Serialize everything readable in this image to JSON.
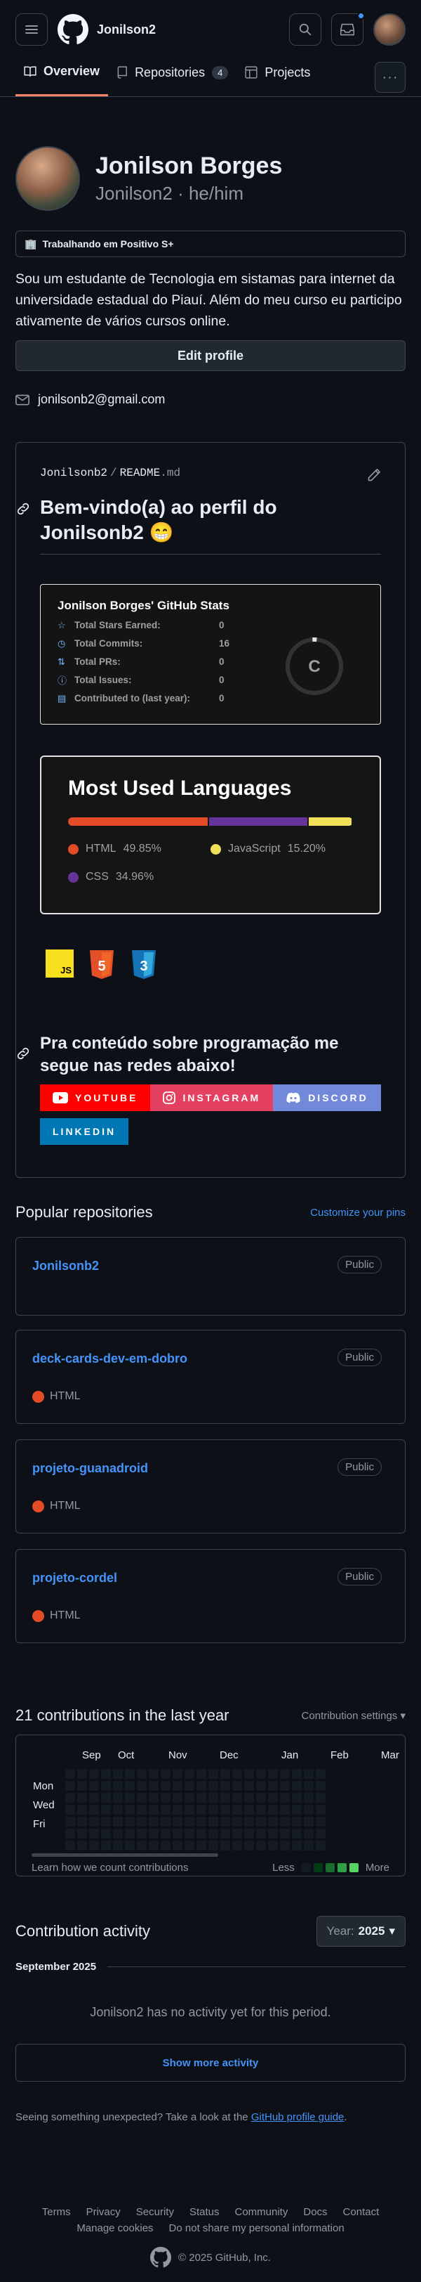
{
  "header": {
    "username": "Jonilson2"
  },
  "tabs": [
    {
      "label": "Overview"
    },
    {
      "label": "Repositories",
      "count": "4"
    },
    {
      "label": "Projects"
    }
  ],
  "profile": {
    "name": "Jonilson Borges",
    "login_pronouns": "Jonilson2 · he/him",
    "status_emoji": "🏢",
    "status": "Trabalhando em Positivo S+",
    "bio": "Sou um estudante de Tecnologia em sistamas para internet da universidade estadual do Piauí. Além do meu curso eu participo ativamente de vários cursos online.",
    "edit_label": "Edit profile",
    "email": "jonilsonb2@gmail.com"
  },
  "readme": {
    "repo": "Jonilsonb2",
    "sep": "/",
    "file": "README",
    "ext": ".md",
    "heading": "Bem-vindo(a) ao perfil do Jonilsonb2 😁",
    "stats_card": {
      "title": "Jonilson Borges' GitHub Stats",
      "rows": [
        {
          "label": "Total Stars Earned:",
          "value": "0"
        },
        {
          "label": "Total Commits:",
          "value": "16"
        },
        {
          "label": "Total PRs:",
          "value": "0"
        },
        {
          "label": "Total Issues:",
          "value": "0"
        },
        {
          "label": "Contributed to (last year):",
          "value": "0"
        }
      ],
      "rank": "C"
    },
    "langs_card": {
      "title": "Most Used Languages",
      "langs": [
        {
          "name": "HTML",
          "pct": "49.85%",
          "value": 49.85,
          "color": "#e34c26"
        },
        {
          "name": "JavaScript",
          "pct": "15.20%",
          "value": 15.2,
          "color": "#f1e05a"
        },
        {
          "name": "CSS",
          "pct": "34.96%",
          "value": 34.96,
          "color": "#663399"
        }
      ]
    },
    "tech_badges": [
      {
        "icon": "javascript-icon",
        "text": "JS"
      },
      {
        "icon": "html5-icon",
        "text": "5"
      },
      {
        "icon": "css3-icon",
        "text": "3"
      }
    ],
    "social_heading": "Pra conteúdo sobre programação me segue nas redes abaixo!",
    "socials": [
      {
        "label": "YOUTUBE",
        "color": "#ff0000",
        "icon": "youtube-icon"
      },
      {
        "label": "INSTAGRAM",
        "color": "#e4405f",
        "icon": "instagram-icon"
      },
      {
        "label": "DISCORD",
        "color": "#7289da",
        "icon": "discord-icon"
      },
      {
        "label": "LINKEDIN",
        "color": "#0077b5",
        "icon": ""
      }
    ]
  },
  "popular": {
    "title": "Popular repositories",
    "customize": "Customize your pins",
    "repos": [
      {
        "name": "Jonilsonb2",
        "visibility": "Public",
        "language": ""
      },
      {
        "name": "deck-cards-dev-em-dobro",
        "visibility": "Public",
        "language": "HTML"
      },
      {
        "name": "projeto-guanadroid",
        "visibility": "Public",
        "language": "HTML"
      },
      {
        "name": "projeto-cordel",
        "visibility": "Public",
        "language": "HTML"
      }
    ]
  },
  "contributions": {
    "title": "21 contributions in the last year",
    "settings": "Contribution settings",
    "months": [
      "Sep",
      "Oct",
      "Nov",
      "Dec",
      "Jan",
      "Feb",
      "Mar"
    ],
    "days": [
      "Mon",
      "Wed",
      "Fri"
    ],
    "learn": "Learn how we count contributions",
    "less": "Less",
    "more": "More",
    "legend_colors": [
      "#151b23",
      "#033a16",
      "#196c2e",
      "#2ea043",
      "#56d364"
    ]
  },
  "activity": {
    "title": "Contribution activity",
    "year_prefix": "Year:",
    "year": "2025",
    "month": "September 2025",
    "empty": "Jonilson2 has no activity yet for this period.",
    "more": "Show more activity",
    "unexpected_text": "Seeing something unexpected? Take a look at the",
    "guide_link": "GitHub profile guide",
    "period": "."
  },
  "footer": {
    "links": [
      "Terms",
      "Privacy",
      "Security",
      "Status",
      "Community",
      "Docs",
      "Contact",
      "Manage cookies",
      "Do not share my personal information"
    ],
    "copyright": "© 2025 GitHub, Inc."
  }
}
